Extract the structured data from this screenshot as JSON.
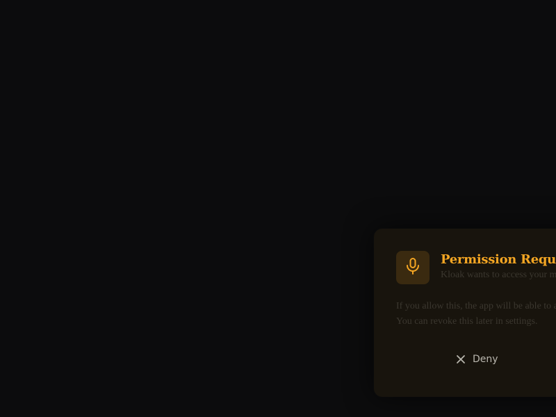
{
  "dialog": {
    "icon": "microphone-icon",
    "title": "Permission Request",
    "subtitle": "Kloak wants to access your m",
    "body_lines": [
      "If you allow this, the app will be able to a",
      "You can revoke this later in settings."
    ],
    "deny_label": "Deny",
    "deny_icon": "close-icon"
  },
  "colors": {
    "background": "#0c0c0d",
    "dialog_background": "#18140d",
    "accent": "#f5a623",
    "icon_box": "#3a2a10",
    "muted_text": "#3b372f",
    "button_text": "#b9b6ae"
  }
}
